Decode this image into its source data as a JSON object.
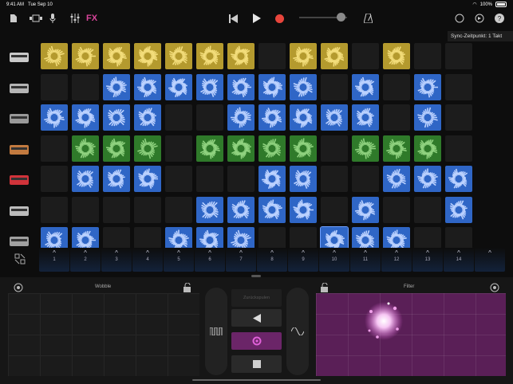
{
  "status": {
    "time": "9:41 AM",
    "date": "Tue Sep 10",
    "battery": "100%"
  },
  "toolbar": {
    "fx_label": "FX",
    "icons": [
      "document-icon",
      "view-toggle-icon",
      "microphone-icon",
      "mixer-icon",
      "rewind-icon",
      "play-icon",
      "record-icon",
      "volume-slider",
      "metronome-icon",
      "loop-icon",
      "settings-icon",
      "help-icon"
    ]
  },
  "sync_label": "Sync-Zeitpunkt: 1 Takt",
  "instruments": [
    "drum-machine-icon",
    "turntable-icon",
    "synth-icon",
    "keyboard-icon",
    "red-keyboard-icon",
    "gong-icon",
    "vibraphone-icon"
  ],
  "grid": [
    [
      "y",
      "y",
      "y",
      "y",
      "y",
      "y",
      "y",
      "",
      "y",
      "y",
      "",
      "y",
      "",
      ""
    ],
    [
      "",
      "",
      "b",
      "b",
      "b",
      "b",
      "b",
      "b",
      "b",
      "",
      "b",
      "",
      "b",
      ""
    ],
    [
      "b",
      "b",
      "b",
      "b",
      "",
      "",
      "b",
      "b",
      "b",
      "b",
      "b",
      "",
      "b",
      ""
    ],
    [
      "",
      "g",
      "g",
      "g",
      "",
      "g",
      "g",
      "g",
      "g",
      "",
      "g",
      "g",
      "g",
      ""
    ],
    [
      "",
      "b",
      "b",
      "b",
      "",
      "",
      "",
      "b",
      "b",
      "",
      "",
      "b",
      "b",
      "b"
    ],
    [
      "",
      "",
      "",
      "",
      "",
      "b",
      "b",
      "b",
      "b",
      "",
      "b",
      "",
      "",
      "b"
    ],
    [
      "b",
      "b",
      "",
      "",
      "b",
      "b",
      "b",
      "",
      "",
      "b",
      "b",
      "b",
      "",
      ""
    ]
  ],
  "triggers": [
    "1",
    "2",
    "3",
    "4",
    "5",
    "6",
    "7",
    "8",
    "9",
    "10",
    "11",
    "12",
    "13",
    "14",
    ""
  ],
  "fx": {
    "left_title": "Wobble",
    "right_title": "Filter",
    "center_top": "Zurückspulen"
  }
}
